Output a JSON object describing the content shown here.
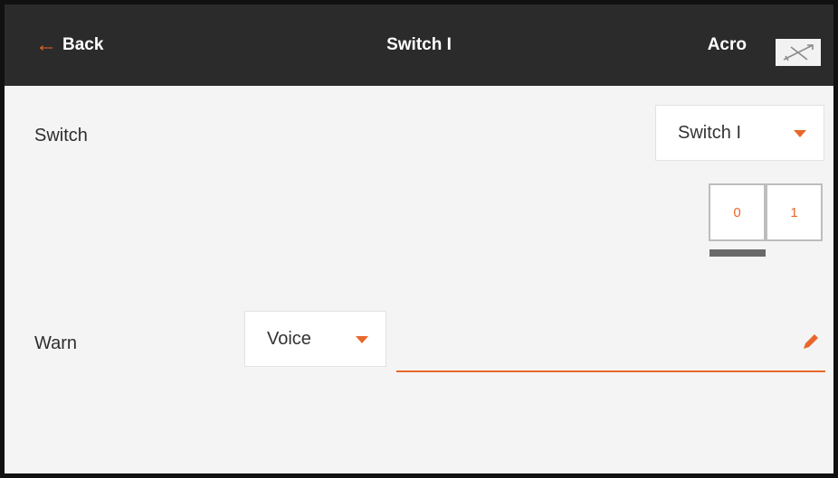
{
  "header": {
    "back_label": "Back",
    "title": "Switch I",
    "model_name": "Acro",
    "model_icon": "airplane-icon"
  },
  "switch_row": {
    "label": "Switch",
    "selected": "Switch I"
  },
  "positions": {
    "items": [
      "0",
      "1"
    ],
    "active_index": 0
  },
  "warn_row": {
    "label": "Warn",
    "type_selected": "Voice",
    "text_value": ""
  },
  "colors": {
    "accent": "#e8672a",
    "header_bg": "#2b2b2b",
    "page_bg": "#f4f4f4"
  }
}
